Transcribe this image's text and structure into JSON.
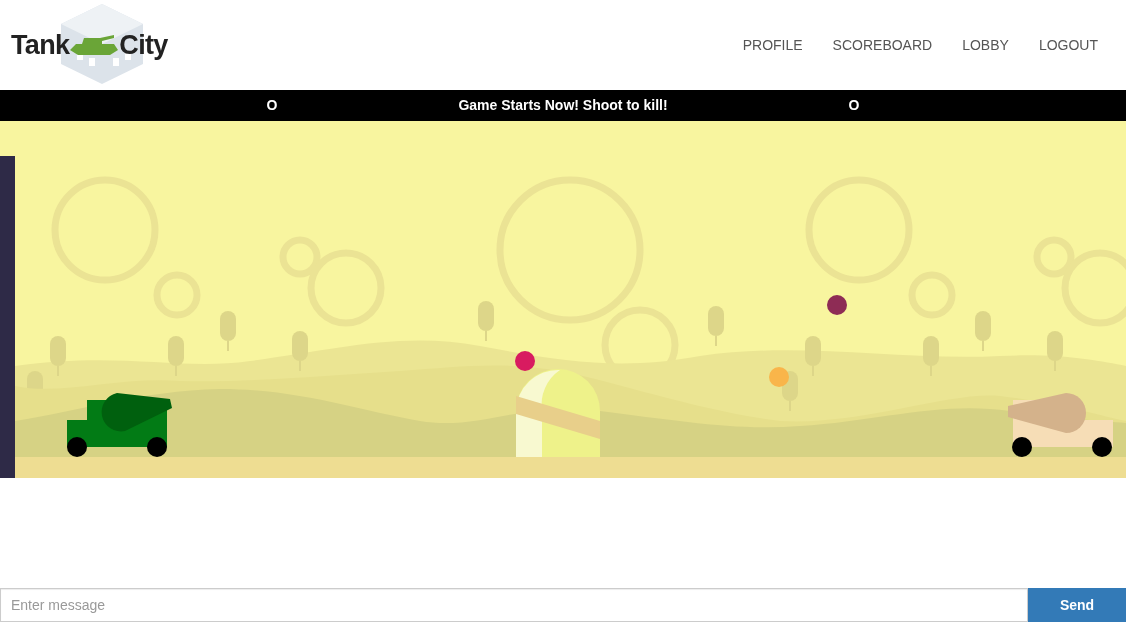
{
  "logo": {
    "word_1": "Tank",
    "word_2": "City"
  },
  "nav": [
    "PROFILE",
    "SCOREBOARD",
    "LOBBY",
    "LOGOUT"
  ],
  "scoreboard": {
    "left_score": "O",
    "message": "Game Starts Now! Shoot to kill!",
    "right_score": "O"
  },
  "chat": {
    "placeholder": "Enter message",
    "send": "Send"
  }
}
